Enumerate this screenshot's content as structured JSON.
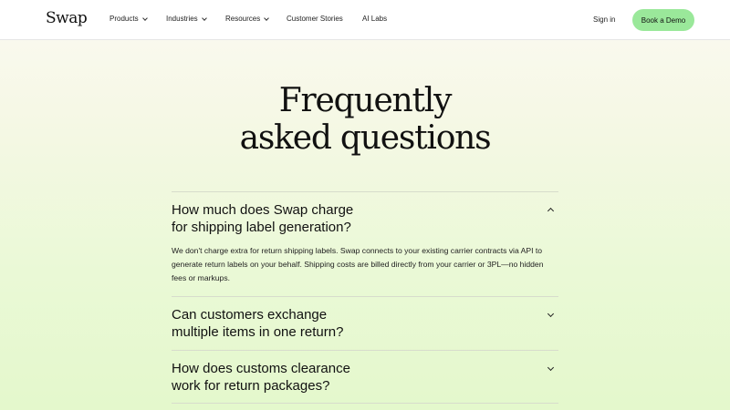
{
  "header": {
    "logo": "Swap",
    "nav": [
      {
        "label": "Products",
        "dropdown": true
      },
      {
        "label": "Industries",
        "dropdown": true
      },
      {
        "label": "Resources",
        "dropdown": true
      },
      {
        "label": "Customer Stories",
        "dropdown": false
      },
      {
        "label": "AI Labs",
        "dropdown": false
      }
    ],
    "signin": "Sign in",
    "cta": "Book a Demo"
  },
  "faq": {
    "title_line1": "Frequently",
    "title_line2": "asked questions",
    "items": [
      {
        "q1": "How much does Swap charge",
        "q2": "for shipping label generation?",
        "expanded": true,
        "answer": "We don't charge extra for return shipping labels. Swap connects to your existing carrier contracts via API to generate return labels on your behalf. Shipping costs are billed directly from your carrier or 3PL—no hidden fees or markups."
      },
      {
        "q1": "Can customers exchange",
        "q2": "multiple items in one return?",
        "expanded": false
      },
      {
        "q1": "How does customs clearance",
        "q2": "work for return packages?",
        "expanded": false
      }
    ]
  },
  "colors": {
    "cta_bg": "#9ae89a",
    "page_gradient_top": "#fbfaf2",
    "page_gradient_bottom": "#e4f8cc"
  },
  "icons": {
    "expanded": "chevron-up-icon",
    "collapsed": "chevron-down-icon",
    "dropdown": "chevron-down-icon"
  }
}
